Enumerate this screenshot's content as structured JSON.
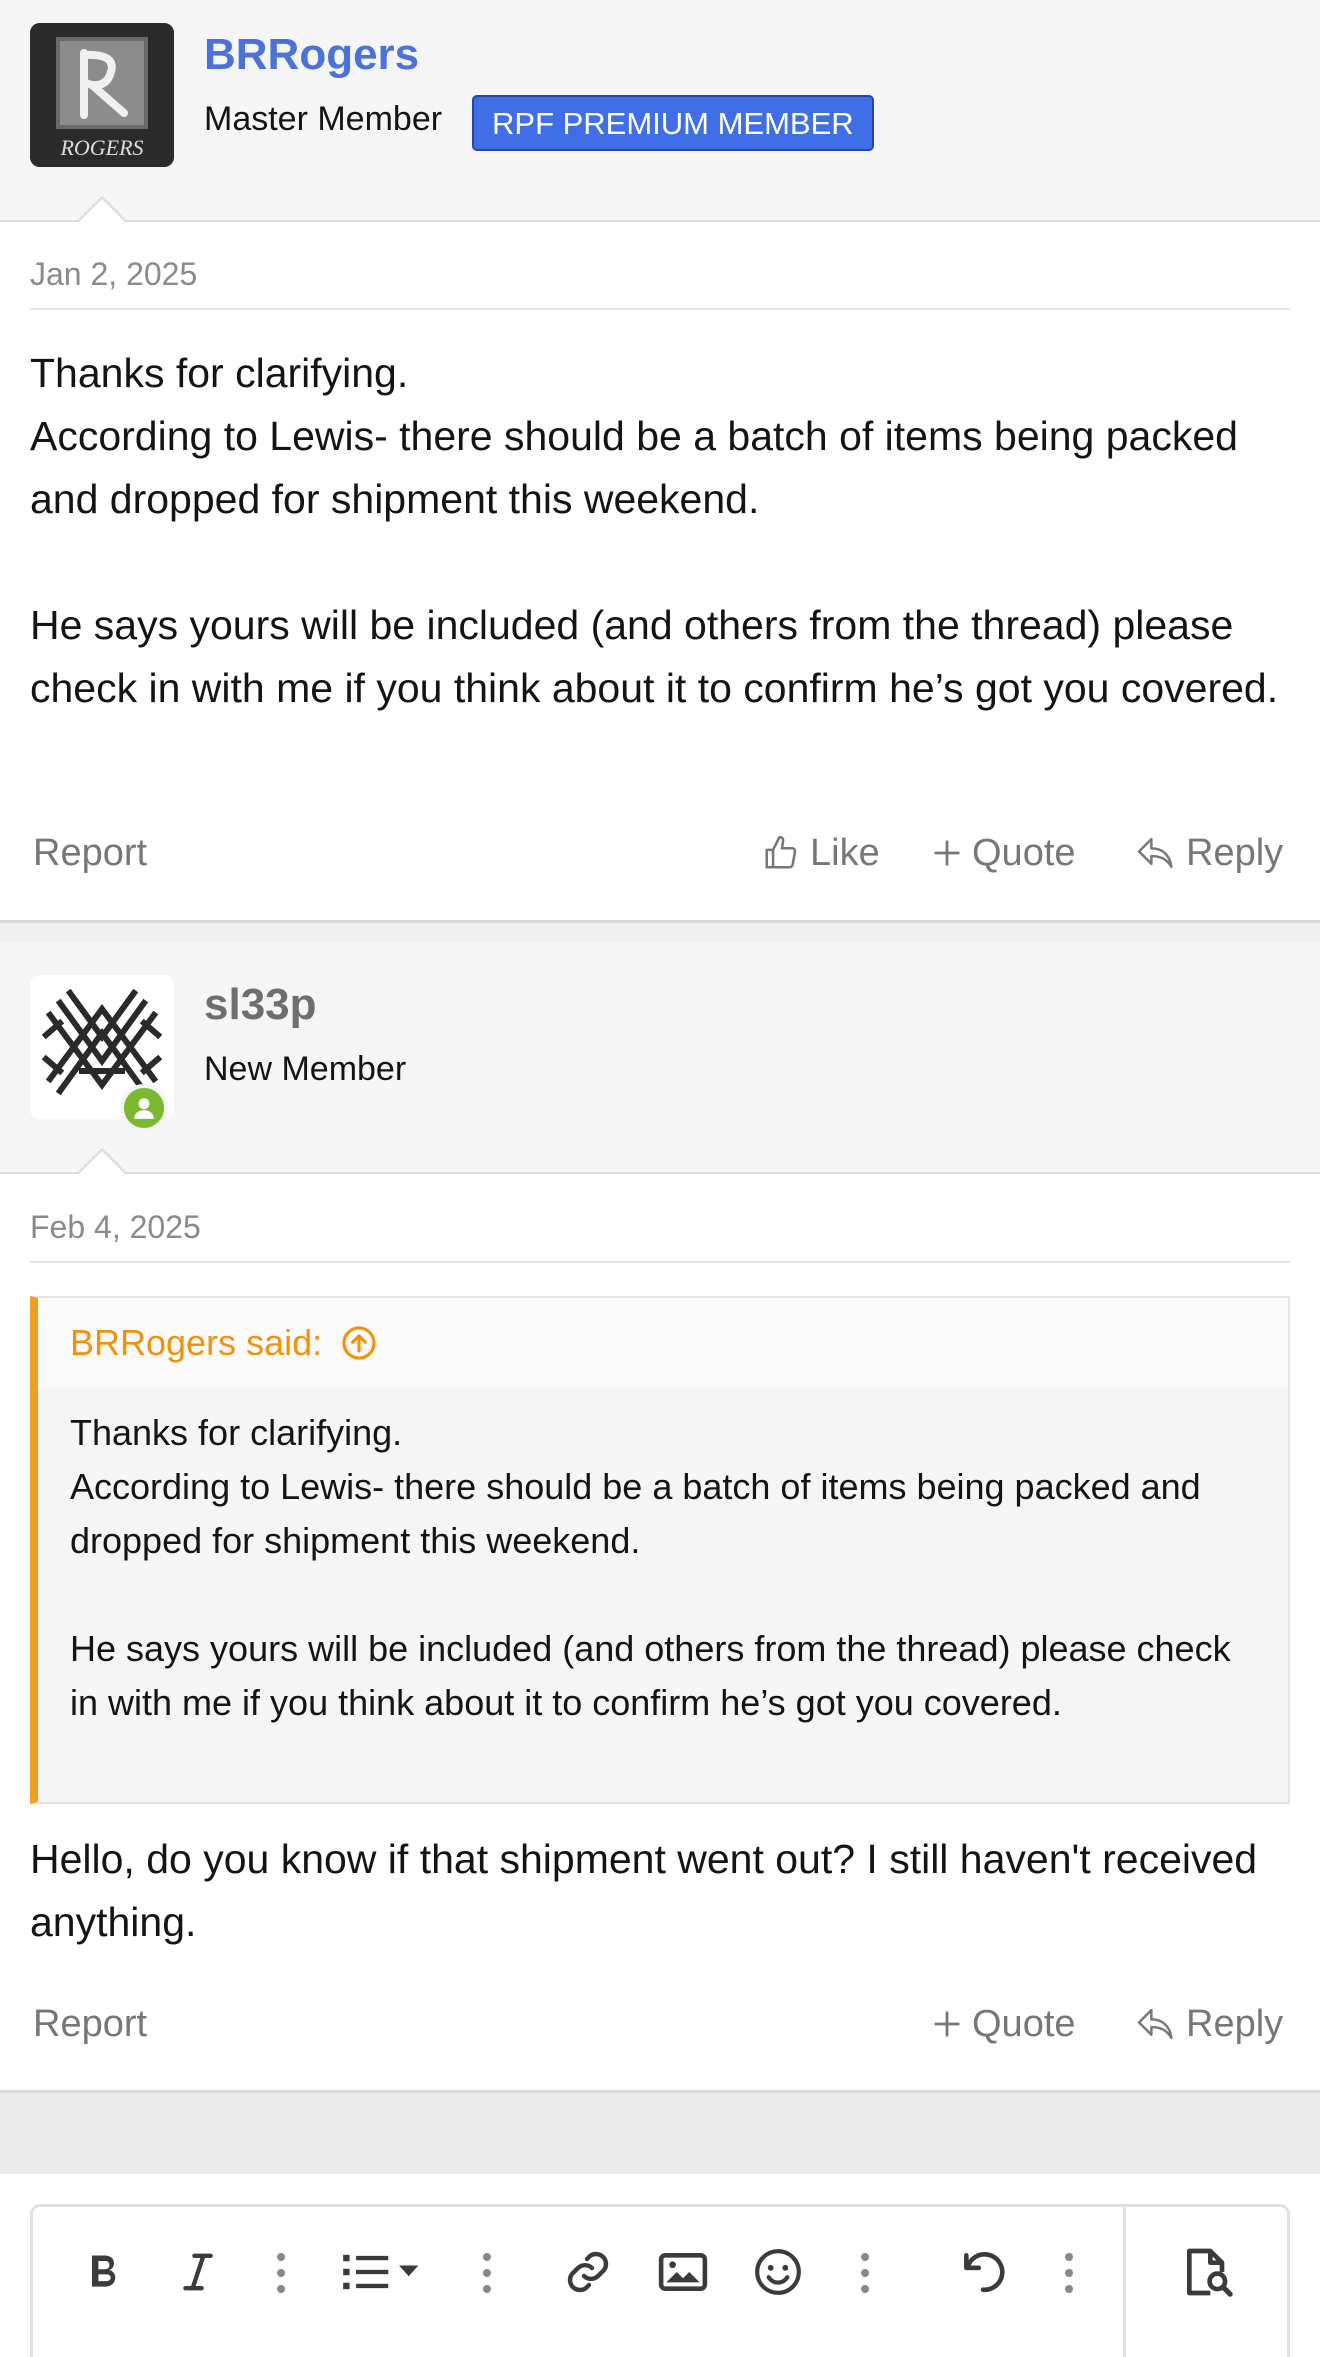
{
  "posts": [
    {
      "author": "BRRogers",
      "author_color": "#4a72d8",
      "avatar_text": "ROGERS",
      "user_title": "Master Member",
      "banner": "RPF PREMIUM MEMBER",
      "date": "Jan 2, 2025",
      "body": [
        "Thanks for clarifying.",
        "According to Lewis- there should be a batch of items being packed and dropped for shipment this weekend.",
        "",
        "He says yours will be included (and others from the thread) please check in with me if you think about it to confirm he’s got you covered."
      ],
      "actions": {
        "report": "Report",
        "like": "Like",
        "quote": "Quote",
        "reply": "Reply"
      }
    },
    {
      "author": "sl33p",
      "author_color": "#6e6e6e",
      "user_title": "New Member",
      "online_badge": true,
      "date": "Feb 4, 2025",
      "quote": {
        "header": "BRRogers said:",
        "body": [
          "Thanks for clarifying.",
          "According to Lewis- there should be a batch of items being packed and dropped for shipment this weekend.",
          "",
          "He says yours will be included (and others from the thread) please check in with me if you think about it to confirm he’s got you covered."
        ]
      },
      "body": "Hello, do you know if that shipment went out? I still haven't received anything.",
      "actions": {
        "report": "Report",
        "quote": "Quote",
        "reply": "Reply"
      }
    }
  ],
  "editor_toolbar": {
    "items": [
      "bold-icon",
      "italic-icon",
      "more-options-icon",
      "list-icon",
      "more-options-icon",
      "link-icon",
      "image-icon",
      "smiley-icon",
      "more-options-icon",
      "undo-icon",
      "more-options-icon",
      "preview-icon"
    ]
  },
  "colors": {
    "accent_blue": "#3f6ee6",
    "quote_orange": "#f0a020",
    "online_green": "#7ab82f"
  }
}
